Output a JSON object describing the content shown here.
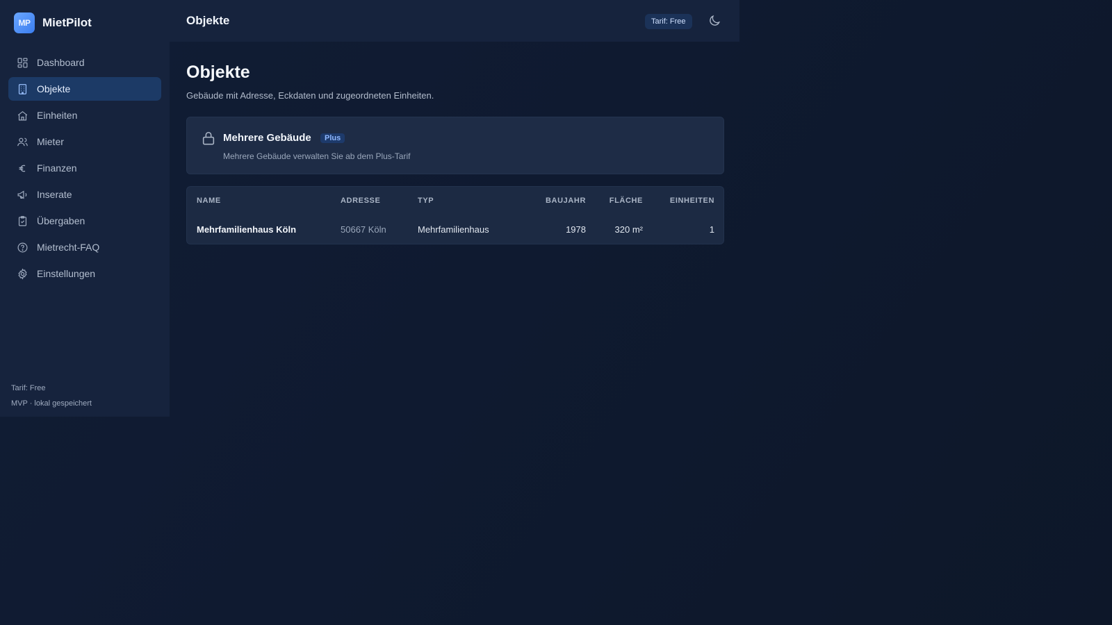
{
  "brand": {
    "logo": "MP",
    "name": "MietPilot"
  },
  "sidebar": {
    "items": [
      {
        "label": "Dashboard",
        "icon": "dashboard-icon",
        "active": false
      },
      {
        "label": "Objekte",
        "icon": "building-icon",
        "active": true
      },
      {
        "label": "Einheiten",
        "icon": "home-icon",
        "active": false
      },
      {
        "label": "Mieter",
        "icon": "users-icon",
        "active": false
      },
      {
        "label": "Finanzen",
        "icon": "euro-icon",
        "active": false
      },
      {
        "label": "Inserate",
        "icon": "megaphone-icon",
        "active": false
      },
      {
        "label": "Übergaben",
        "icon": "clipboard-icon",
        "active": false
      },
      {
        "label": "Mietrecht-FAQ",
        "icon": "help-circle-icon",
        "active": false
      },
      {
        "label": "Einstellungen",
        "icon": "gear-icon",
        "active": false
      }
    ],
    "footer": {
      "plan": "Tarif: Free",
      "storage": "MVP · lokal gespeichert"
    }
  },
  "topbar": {
    "title": "Objekte",
    "tariff": "Tarif: Free",
    "theme_icon": "moon-icon"
  },
  "page": {
    "title": "Objekte",
    "subtitle": "Gebäude mit Adresse, Eckdaten und zugeordneten Einheiten."
  },
  "upsell": {
    "icon": "lock-icon",
    "title": "Mehrere Gebäude",
    "badge": "Plus",
    "description": "Mehrere Gebäude verwalten Sie ab dem Plus-Tarif"
  },
  "table": {
    "headers": [
      "NAME",
      "ADRESSE",
      "TYP",
      "BAUJAHR",
      "FLÄCHE",
      "EINHEITEN"
    ],
    "rows": [
      {
        "name": "Mehrfamilienhaus Köln",
        "address": "50667 Köln",
        "type": "Mehrfamilienhaus",
        "year": "1978",
        "area": "320 m²",
        "units": "1"
      }
    ]
  },
  "colors": {
    "accent": "#3b7ef0",
    "background": "#0f1a30",
    "sidebar": "#16233d"
  }
}
